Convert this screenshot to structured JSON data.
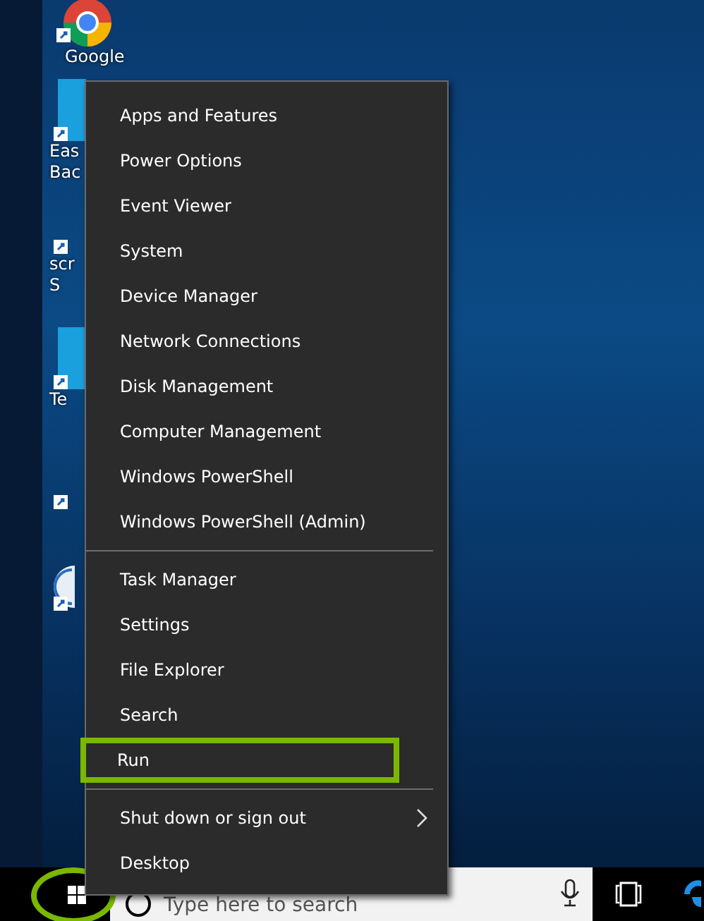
{
  "desktop_icons": [
    {
      "kind": "chrome",
      "labels": [
        "Google"
      ]
    },
    {
      "kind": "tile",
      "labels": [
        "Eas",
        "Bac"
      ]
    },
    {
      "kind": "shortcut",
      "labels": [
        "scr",
        "S"
      ]
    },
    {
      "kind": "tile",
      "labels": [
        "Te"
      ]
    },
    {
      "kind": "shortcut"
    },
    {
      "kind": "round"
    }
  ],
  "context_menu": {
    "groups": [
      {
        "items": [
          {
            "label": "Apps and Features",
            "highlighted": false
          },
          {
            "label": "Power Options",
            "highlighted": false
          },
          {
            "label": "Event Viewer",
            "highlighted": false
          },
          {
            "label": "System",
            "highlighted": false
          },
          {
            "label": "Device Manager",
            "highlighted": false
          },
          {
            "label": "Network Connections",
            "highlighted": false
          },
          {
            "label": "Disk Management",
            "highlighted": false
          },
          {
            "label": "Computer Management",
            "highlighted": false
          },
          {
            "label": "Windows PowerShell",
            "highlighted": false
          },
          {
            "label": "Windows PowerShell (Admin)",
            "highlighted": false
          }
        ]
      },
      {
        "items": [
          {
            "label": "Task Manager",
            "highlighted": false
          },
          {
            "label": "Settings",
            "highlighted": false
          },
          {
            "label": "File Explorer",
            "highlighted": false
          },
          {
            "label": "Search",
            "highlighted": false
          },
          {
            "label": "Run",
            "highlighted": true
          }
        ]
      },
      {
        "items": [
          {
            "label": "Shut down or sign out",
            "highlighted": false,
            "submenu": true
          },
          {
            "label": "Desktop",
            "highlighted": false
          }
        ]
      }
    ]
  },
  "taskbar": {
    "start_button": {
      "circled": true
    },
    "search": {
      "placeholder": "Type here to search"
    }
  }
}
